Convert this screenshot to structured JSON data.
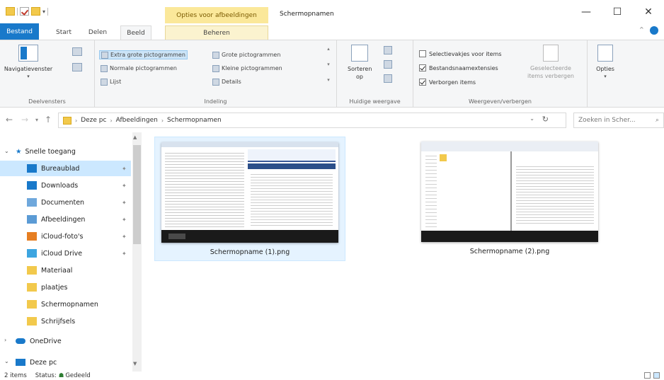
{
  "window": {
    "title": "Schermopnamen",
    "context_tab": "Opties voor afbeeldingen",
    "controls": {
      "minimize": "—",
      "maximize": "☐",
      "close": "✕"
    }
  },
  "tabs": {
    "file": "Bestand",
    "home": "Start",
    "share": "Delen",
    "view": "Beeld",
    "manage": "Beheren"
  },
  "ribbon": {
    "panes": {
      "label": "Deelvensters",
      "nav_pane": "Navigatievenster"
    },
    "layout": {
      "label": "Indeling",
      "items": [
        {
          "label": "Extra grote pictogrammen",
          "selected": true
        },
        {
          "label": "Normale pictogrammen",
          "selected": false
        },
        {
          "label": "Lijst",
          "selected": false
        },
        {
          "label": "Grote pictogrammen",
          "selected": false
        },
        {
          "label": "Kleine pictogrammen",
          "selected": false
        },
        {
          "label": "Details",
          "selected": false
        }
      ]
    },
    "current_view": {
      "label": "Huidige weergave",
      "sort": "Sorteren op"
    },
    "show_hide": {
      "label": "Weergeven/verbergen",
      "checkboxes": [
        {
          "label": "Selectievakjes voor items",
          "checked": false
        },
        {
          "label": "Bestandsnaamextensies",
          "checked": true
        },
        {
          "label": "Verborgen items",
          "checked": true
        }
      ],
      "hide_selected": "Geselecteerde items verbergen"
    },
    "options": "Opties"
  },
  "address": {
    "crumbs": [
      "Deze pc",
      "Afbeeldingen",
      "Schermopnamen"
    ],
    "search_placeholder": "Zoeken in Scher..."
  },
  "nav": {
    "quick_access": "Snelle toegang",
    "items": [
      {
        "label": "Bureaublad",
        "icon": "desktop-icon",
        "color": "#1979ca",
        "pinned": true
      },
      {
        "label": "Downloads",
        "icon": "download-icon",
        "color": "#1979ca",
        "pinned": true
      },
      {
        "label": "Documenten",
        "icon": "document-icon",
        "color": "#6fa8dc",
        "pinned": true
      },
      {
        "label": "Afbeeldingen",
        "icon": "pictures-icon",
        "color": "#5b9bd5",
        "pinned": true
      },
      {
        "label": "iCloud-foto's",
        "icon": "icloud-photos-icon",
        "color": "#e67e22",
        "pinned": true
      },
      {
        "label": "iCloud Drive",
        "icon": "icloud-drive-icon",
        "color": "#3da5e0",
        "pinned": true
      },
      {
        "label": "Materiaal",
        "icon": "folder-icon",
        "color": "#f2c94c",
        "pinned": false
      },
      {
        "label": "plaatjes",
        "icon": "folder-icon",
        "color": "#f2c94c",
        "pinned": false
      },
      {
        "label": "Schermopnamen",
        "icon": "folder-icon",
        "color": "#f2c94c",
        "pinned": false
      },
      {
        "label": "Schrijfsels",
        "icon": "folder-icon",
        "color": "#f2c94c",
        "pinned": false
      }
    ],
    "onedrive": "OneDrive",
    "this_pc": "Deze pc"
  },
  "files": [
    {
      "name": "Schermopname (1).png",
      "selected": true
    },
    {
      "name": "Schermopname (2).png",
      "selected": false
    }
  ],
  "status": {
    "count": "2 items",
    "status_label": "Status:",
    "status_value": "Gedeeld"
  },
  "colors": {
    "accent": "#1979ca",
    "selection": "#cce8ff",
    "context_tab": "#fbe89a"
  }
}
